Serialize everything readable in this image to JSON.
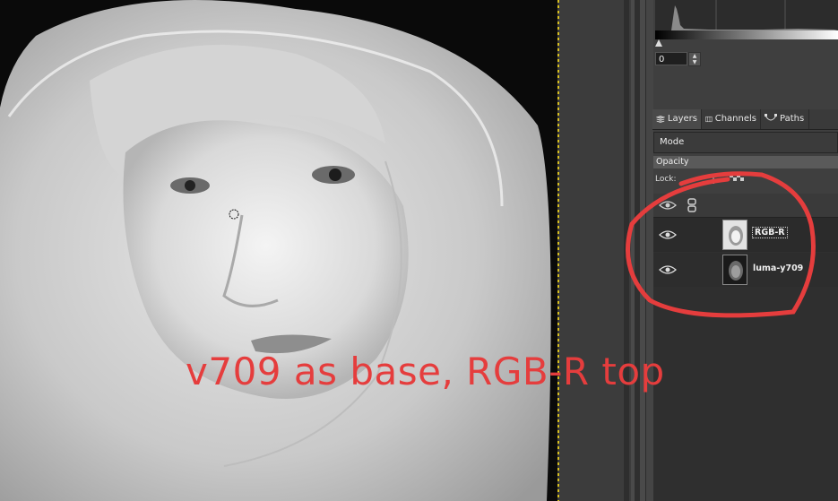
{
  "canvas": {
    "image_description": "grayscale-portrait"
  },
  "histogram": {
    "input_value": "0"
  },
  "tabs": [
    {
      "label": "Layers",
      "icon": "layers-icon"
    },
    {
      "label": "Channels",
      "icon": "channels-icon"
    },
    {
      "label": "Paths",
      "icon": "paths-icon"
    }
  ],
  "layers_panel": {
    "mode_label": "Mode",
    "opacity_label": "Opacity",
    "lock_label": "Lock:",
    "layers": [
      {
        "name": "RGB-R",
        "visible": true,
        "selected": true
      },
      {
        "name": "luma-y709",
        "visible": true,
        "selected": false
      }
    ]
  },
  "annotation": {
    "text": "v709 as base, RGB-R top",
    "color": "#e53d3d"
  }
}
